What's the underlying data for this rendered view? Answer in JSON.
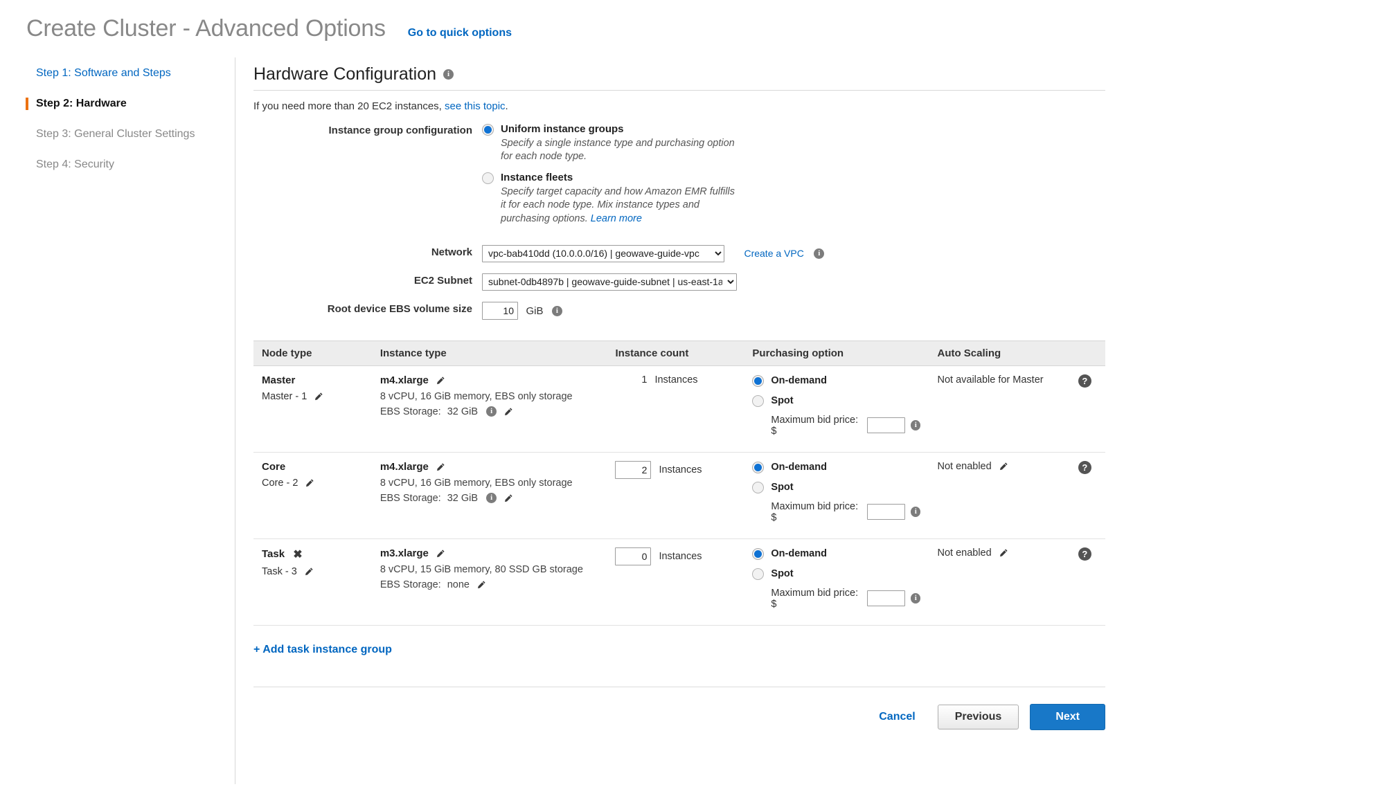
{
  "header": {
    "title": "Create Cluster - Advanced Options",
    "quick_options_link": "Go to quick options"
  },
  "sidebar": {
    "items": [
      {
        "label": "Step 1: Software and Steps",
        "state": "done"
      },
      {
        "label": "Step 2: Hardware",
        "state": "current"
      },
      {
        "label": "Step 3: General Cluster Settings",
        "state": "future"
      },
      {
        "label": "Step 4: Security",
        "state": "future"
      }
    ]
  },
  "main": {
    "section_title": "Hardware Configuration",
    "section_info_icon": "info-icon",
    "intro_prefix": "If you need more than 20 EC2 instances, ",
    "intro_link": "see this topic",
    "intro_suffix": ".",
    "instance_group_config": {
      "label": "Instance group configuration",
      "options": [
        {
          "label": "Uniform instance groups",
          "description": "Specify a single instance type and purchasing option for each node type.",
          "selected": true
        },
        {
          "label": "Instance fleets",
          "description": "Specify target capacity and how Amazon EMR fulfills it for each node type. Mix instance types and purchasing options.",
          "learn_more": "Learn more",
          "selected": false
        }
      ]
    },
    "network": {
      "label": "Network",
      "value": "vpc-bab410dd (10.0.0.0/16) | geowave-guide-vpc",
      "create_vpc_link": "Create a VPC"
    },
    "subnet": {
      "label": "EC2 Subnet",
      "value": "subnet-0db4897b | geowave-guide-subnet | us-east-1a"
    },
    "root_ebs": {
      "label": "Root device EBS volume size",
      "value": "10",
      "unit": "GiB"
    }
  },
  "table": {
    "columns": [
      "Node type",
      "Instance type",
      "Instance count",
      "Purchasing option",
      "Auto Scaling",
      ""
    ],
    "rows": [
      {
        "node_type": "Master",
        "node_removable": false,
        "node_sub": "Master - 1",
        "instance_type": "m4.xlarge",
        "instance_spec": "8 vCPU, 16 GiB memory, EBS only storage",
        "ebs_label": "EBS Storage:",
        "ebs_value": "32 GiB",
        "ebs_has_info": true,
        "instance_count": "1",
        "count_editable": false,
        "count_label": "Instances",
        "purchasing": {
          "on_demand_label": "On-demand",
          "spot_label": "Spot",
          "selected": "on-demand",
          "bid_label": "Maximum bid price: $",
          "bid_value": ""
        },
        "auto_scaling": "Not available for Master",
        "auto_scaling_editable": false
      },
      {
        "node_type": "Core",
        "node_removable": false,
        "node_sub": "Core - 2",
        "instance_type": "m4.xlarge",
        "instance_spec": "8 vCPU, 16 GiB memory, EBS only storage",
        "ebs_label": "EBS Storage:",
        "ebs_value": "32 GiB",
        "ebs_has_info": true,
        "instance_count": "2",
        "count_editable": true,
        "count_label": "Instances",
        "purchasing": {
          "on_demand_label": "On-demand",
          "spot_label": "Spot",
          "selected": "on-demand",
          "bid_label": "Maximum bid price: $",
          "bid_value": ""
        },
        "auto_scaling": "Not enabled",
        "auto_scaling_editable": true
      },
      {
        "node_type": "Task",
        "node_removable": true,
        "node_sub": "Task - 3",
        "instance_type": "m3.xlarge",
        "instance_spec": "8 vCPU, 15 GiB memory, 80 SSD GB storage",
        "ebs_label": "EBS Storage:",
        "ebs_value": "none",
        "ebs_has_info": false,
        "instance_count": "0",
        "count_editable": true,
        "count_label": "Instances",
        "purchasing": {
          "on_demand_label": "On-demand",
          "spot_label": "Spot",
          "selected": "on-demand",
          "bid_label": "Maximum bid price: $",
          "bid_value": ""
        },
        "auto_scaling": "Not enabled",
        "auto_scaling_editable": true
      }
    ]
  },
  "footer": {
    "add_task_link": "+ Add task instance group",
    "cancel_label": "Cancel",
    "previous_label": "Previous",
    "next_label": "Next"
  },
  "colors": {
    "accent_blue": "#0066c0",
    "radio_blue": "#0f72d4",
    "next_button": "#1878c8",
    "current_step_marker": "#ec7211",
    "table_header_bg": "#ededed"
  }
}
